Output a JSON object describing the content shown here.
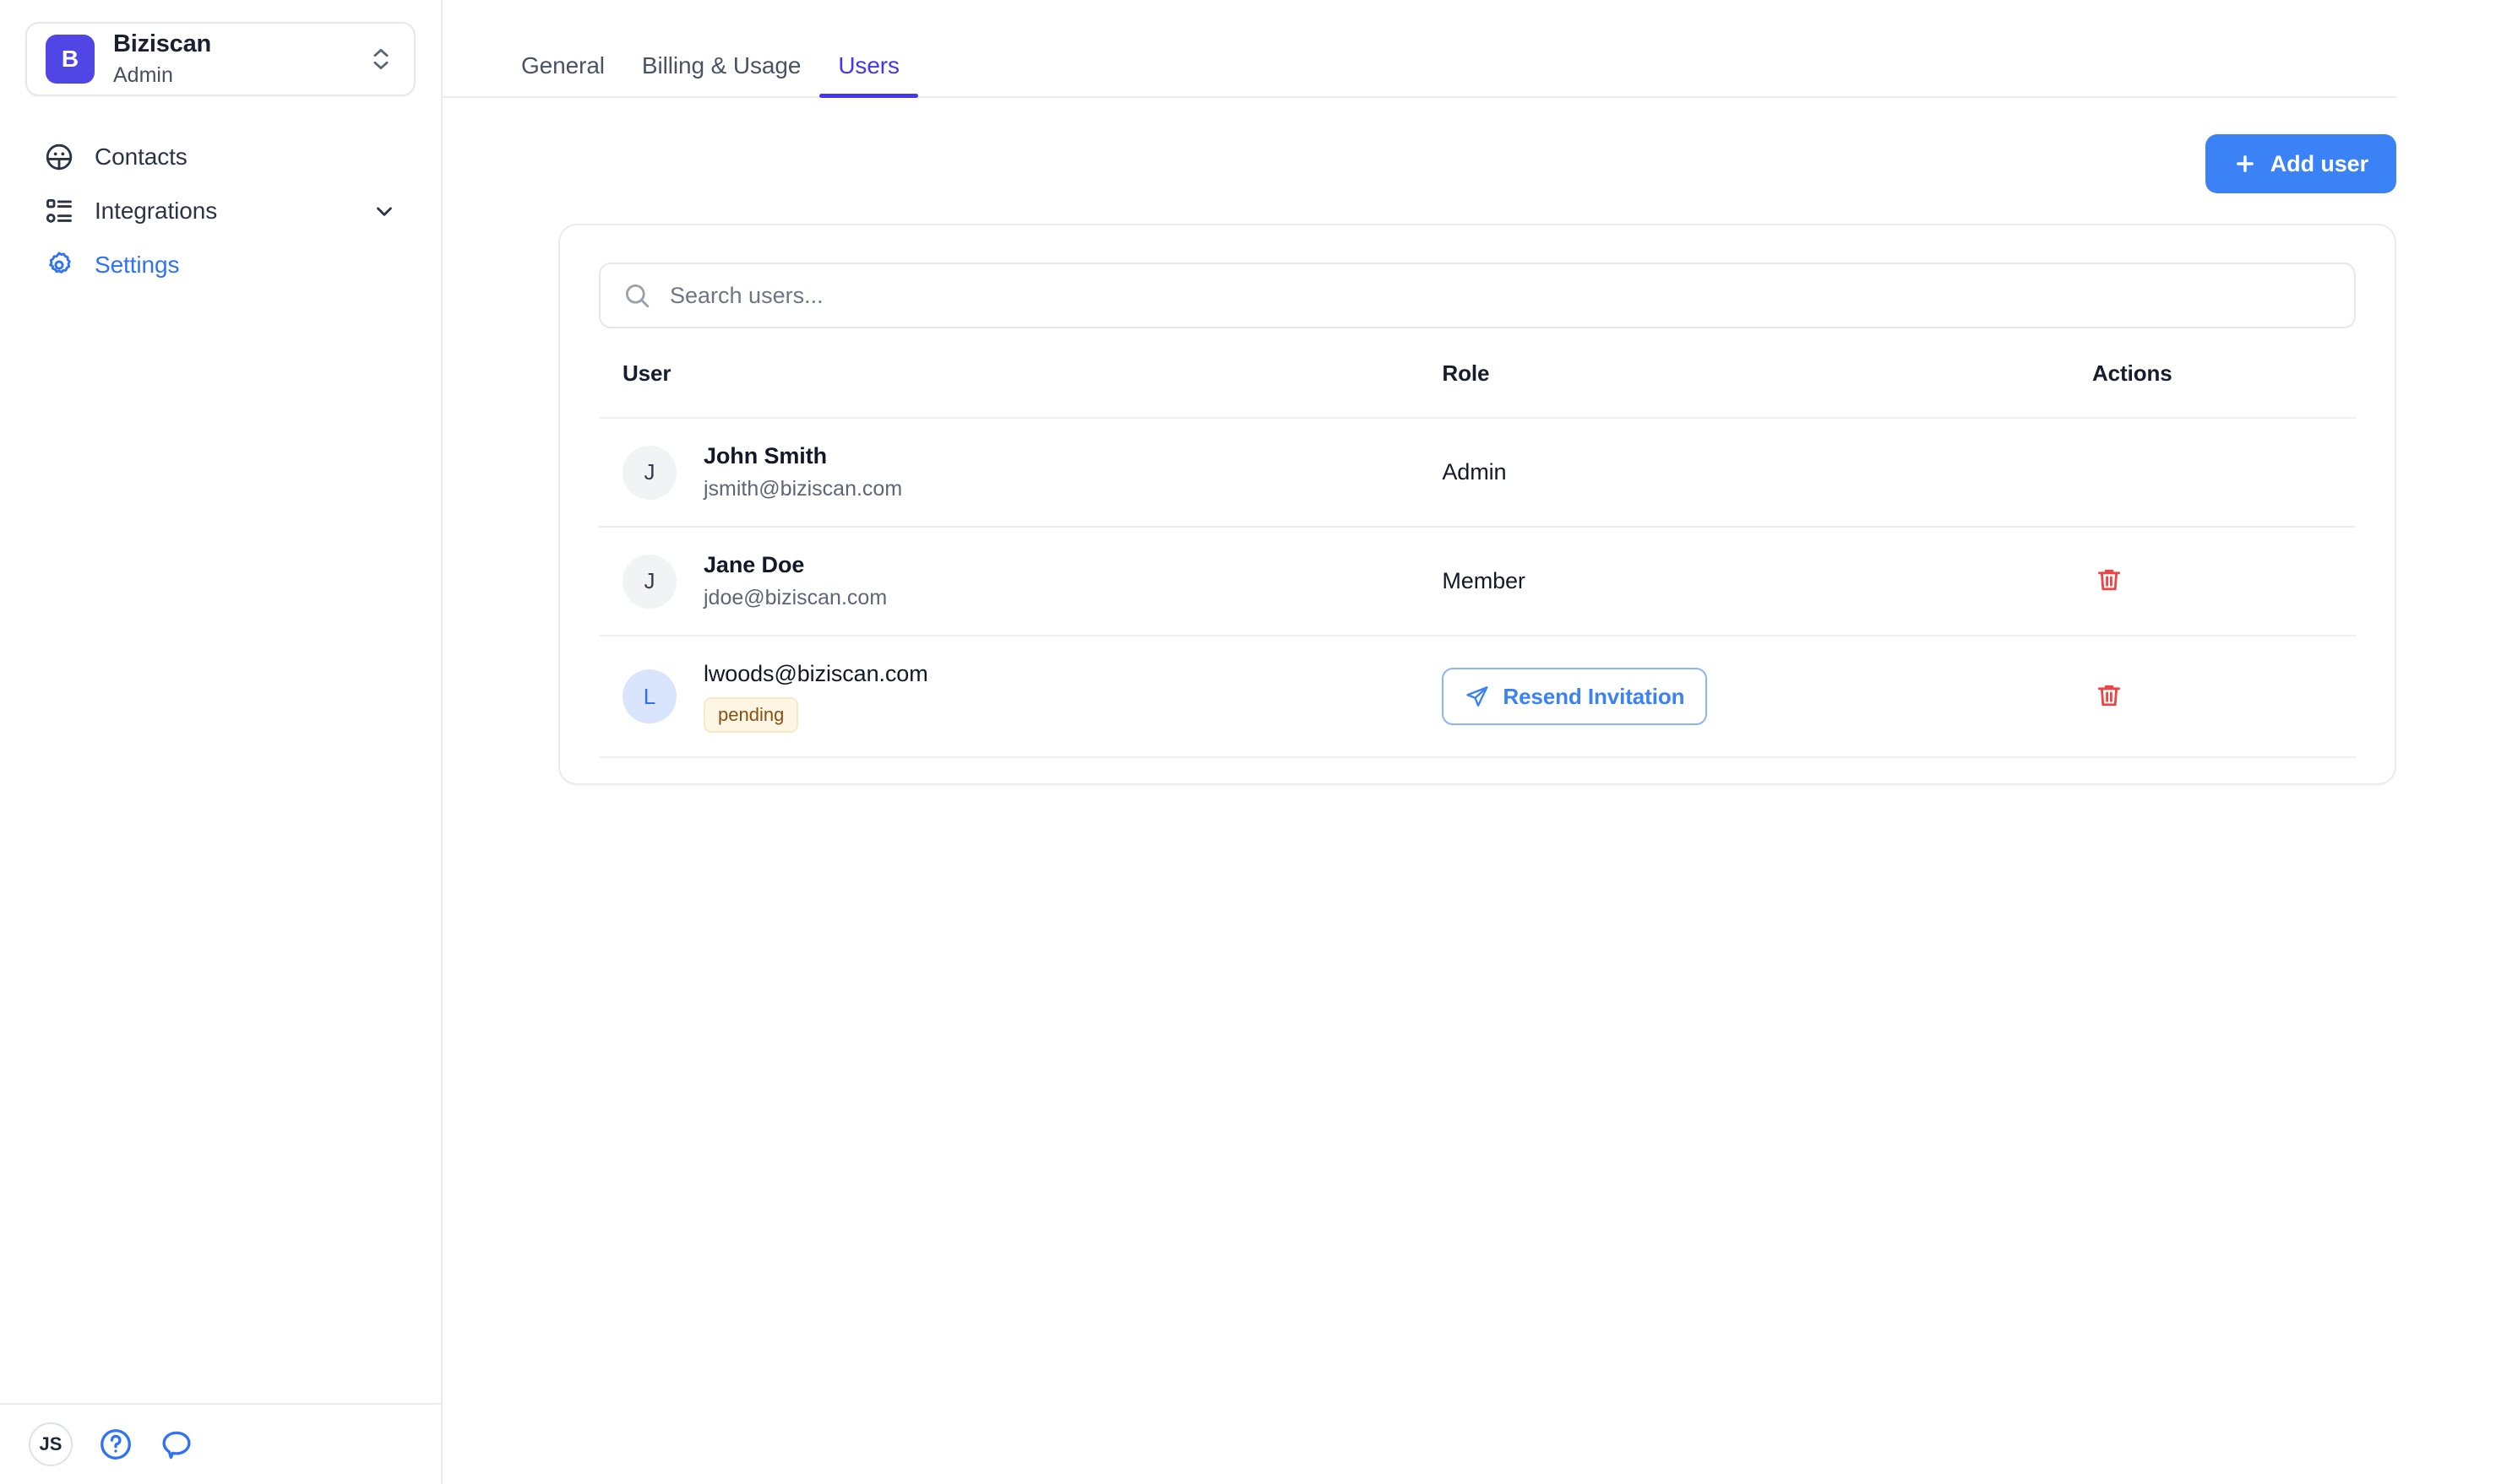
{
  "sidebar": {
    "workspace": {
      "logo_initial": "B",
      "name": "Biziscan",
      "role": "Admin",
      "switcher_icon": "chevron-up-down-icon"
    },
    "items": [
      {
        "label": "Contacts",
        "icon": "contacts-icon",
        "active": false,
        "expandable": false
      },
      {
        "label": "Integrations",
        "icon": "integrations-icon",
        "active": false,
        "expandable": true
      },
      {
        "label": "Settings",
        "icon": "gear-icon",
        "active": true,
        "expandable": false
      }
    ],
    "footer": {
      "user_initials": "JS",
      "help_icon": "question-circle-icon",
      "chat_icon": "chat-bubble-icon"
    }
  },
  "main": {
    "tabs": [
      {
        "label": "General",
        "active": false
      },
      {
        "label": "Billing & Usage",
        "active": false
      },
      {
        "label": "Users",
        "active": true
      }
    ],
    "toolbar": {
      "add_user_label": "Add user",
      "add_user_icon": "plus-icon"
    },
    "search": {
      "placeholder": "Search users...",
      "value": "",
      "icon": "search-icon"
    },
    "table": {
      "headers": {
        "user": "User",
        "role": "Role",
        "actions": "Actions"
      },
      "rows": [
        {
          "avatar_initial": "J",
          "name": "John Smith",
          "email": "jsmith@biziscan.com",
          "role": "Admin",
          "status": "",
          "has_resend": false,
          "has_delete": false
        },
        {
          "avatar_initial": "J",
          "name": "Jane Doe",
          "email": "jdoe@biziscan.com",
          "role": "Member",
          "status": "",
          "has_resend": false,
          "has_delete": true
        },
        {
          "avatar_initial": "L",
          "name": "",
          "email": "lwoods@biziscan.com",
          "role": "",
          "status": "pending",
          "has_resend": true,
          "resend_label": "Resend Invitation",
          "has_delete": true
        }
      ]
    }
  },
  "colors": {
    "brand_indigo": "#4f46e5",
    "tab_active": "#4338f0",
    "primary_blue": "#3b82f6",
    "link_blue": "#2f72f5",
    "danger_red": "#ef4444",
    "badge_bg": "#fdf6e4",
    "badge_text": "#8a4f11",
    "border": "#e9ebef"
  }
}
